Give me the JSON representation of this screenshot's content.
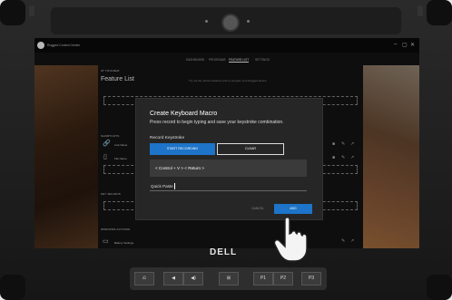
{
  "app": {
    "title": "Rugged Control Center",
    "window_controls": [
      "–",
      "▢",
      "✕"
    ]
  },
  "nav": {
    "tabs": [
      {
        "label": "DASHBOARD",
        "active": false
      },
      {
        "label": "PROGRAMS",
        "active": false
      },
      {
        "label": "FEATURE LIST",
        "active": true
      },
      {
        "label": "SETTINGS",
        "active": false
      }
    ]
  },
  "panel": {
    "section_top": "AT TOOLBAR",
    "title": "Feature List",
    "description": "Try out the various features and re-program your Rugged device.",
    "shortcuts_label": "SHORTCUTS",
    "shortcut_rows": [
      {
        "label": "Link Name",
        "icon": "link-icon"
      },
      {
        "label": "File Name",
        "icon": "file-icon"
      }
    ],
    "key_macros_label": "KEY MACROS",
    "windows_actions_label": "WINDOWS ACTIONS",
    "battery_label": "Battery Settings"
  },
  "dialog": {
    "title": "Create Keyboard Macro",
    "subtitle": "Press record to begin typing and save your keystroke combination.",
    "record_label": "Record Keystroke",
    "start_button": "START RECORDING",
    "clear_button": "CLEAR",
    "keystrokes": "< Control + V > < Return >",
    "macro_name": "Quick Paste",
    "cancel_button": "CANCEL",
    "add_button": "ADD"
  },
  "device": {
    "brand": "DELL",
    "hw_buttons": [
      "⎌",
      "◀",
      "◀)",
      "⊞",
      "P1",
      "P2",
      "P3"
    ]
  },
  "colors": {
    "accent": "#1d74c8",
    "dialog_bg": "#262626",
    "panel_bg": "#141414"
  }
}
